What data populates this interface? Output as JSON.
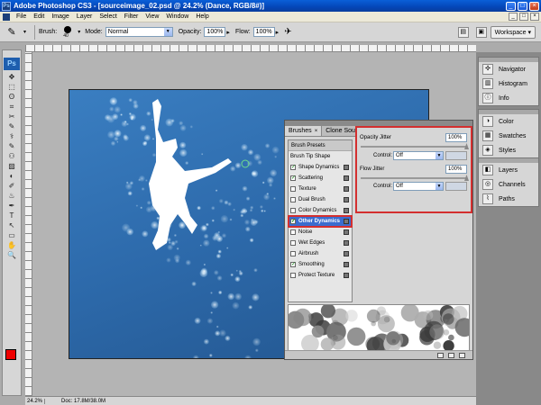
{
  "window": {
    "title": "Adobe Photoshop CS3 - [sourceimage_02.psd @ 24.2% (Dance, RGB/8#)]",
    "app_icon": "Ps",
    "min": "_",
    "max": "□",
    "close": "×"
  },
  "menu": [
    "File",
    "Edit",
    "Image",
    "Layer",
    "Select",
    "Filter",
    "View",
    "Window",
    "Help"
  ],
  "options": {
    "brush_label": "Brush:",
    "brush_size": "40",
    "mode_label": "Mode:",
    "mode_value": "Normal",
    "opacity_label": "Opacity:",
    "opacity_value": "100%",
    "flow_label": "Flow:",
    "flow_value": "100%",
    "workspace_label": "Workspace ▾"
  },
  "toolbox": {
    "badge": "Ps",
    "tools": [
      "✥",
      "⬚",
      "ʘ",
      "⌗",
      "✂",
      "✎",
      "⚕",
      "✎",
      "⚇",
      "▨",
      "◐",
      "✐",
      "♨",
      "✒",
      "T",
      "↖",
      "▭",
      "✋",
      "🔍"
    ]
  },
  "dock": {
    "groups": [
      {
        "items": [
          {
            "icon": "navigator-icon",
            "glyph": "✣",
            "label": "Navigator"
          },
          {
            "icon": "histogram-icon",
            "glyph": "▥",
            "label": "Histogram"
          },
          {
            "icon": "info-icon",
            "glyph": "ⓘ",
            "label": "Info"
          }
        ]
      },
      {
        "items": [
          {
            "icon": "color-icon",
            "glyph": "◑",
            "label": "Color"
          },
          {
            "icon": "swatches-icon",
            "glyph": "▦",
            "label": "Swatches"
          },
          {
            "icon": "styles-icon",
            "glyph": "◈",
            "label": "Styles"
          }
        ]
      },
      {
        "items": [
          {
            "icon": "layers-icon",
            "glyph": "◧",
            "label": "Layers"
          },
          {
            "icon": "channels-icon",
            "glyph": "◎",
            "label": "Channels"
          },
          {
            "icon": "paths-icon",
            "glyph": "⌇",
            "label": "Paths"
          }
        ]
      }
    ]
  },
  "brushes": {
    "tab_brushes": "Brushes",
    "tab_close": "×",
    "tab_clone": "Clone Source",
    "menu_glyph": "≡",
    "header1": "Brush Presets",
    "header2": "Brush Tip Shape",
    "items": [
      {
        "label": "Shape Dynamics",
        "checked": true
      },
      {
        "label": "Scattering",
        "checked": true
      },
      {
        "label": "Texture",
        "checked": false
      },
      {
        "label": "Dual Brush",
        "checked": false
      },
      {
        "label": "Color Dynamics",
        "checked": false
      },
      {
        "label": "Other Dynamics",
        "checked": true,
        "selected": true
      },
      {
        "label": "Noise",
        "checked": false
      },
      {
        "label": "Wet Edges",
        "checked": false
      },
      {
        "label": "Airbrush",
        "checked": false
      },
      {
        "label": "Smoothing",
        "checked": true
      },
      {
        "label": "Protect Texture",
        "checked": false
      }
    ],
    "opacity_jitter_label": "Opacity Jitter",
    "opacity_jitter_value": "100%",
    "flow_jitter_label": "Flow Jitter",
    "flow_jitter_value": "100%",
    "control_label": "Control:",
    "control_value": "Off"
  },
  "status": {
    "zoom": "24.2%",
    "doc": "Doc: 17.8M/38.0M"
  }
}
